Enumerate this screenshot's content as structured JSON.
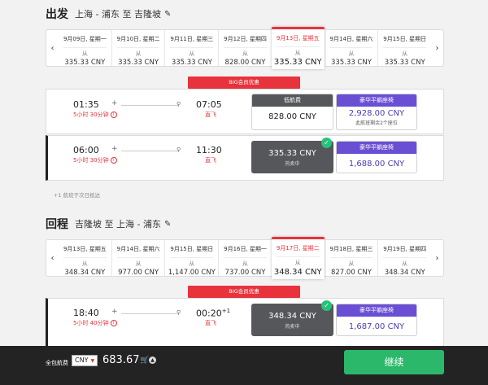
{
  "outbound": {
    "title": "出发",
    "route": "上海 - 浦东 至 吉隆坡",
    "dates": [
      {
        "date": "9月09日, 星期一",
        "from": "从",
        "price": "335.33 CNY"
      },
      {
        "date": "9月10日, 星期二",
        "from": "从",
        "price": "335.33 CNY"
      },
      {
        "date": "9月11日, 星期三",
        "from": "从",
        "price": "335.33 CNY"
      },
      {
        "date": "9月12日, 星期四",
        "from": "从",
        "price": "828.00 CNY"
      },
      {
        "date": "9月13日, 星期五",
        "from": "从",
        "price": "335.33 CNY"
      },
      {
        "date": "9月14日, 星期六",
        "from": "从",
        "price": "335.33 CNY"
      },
      {
        "date": "9月15日, 星期日",
        "from": "从",
        "price": "335.33 CNY"
      }
    ],
    "big_tag": "BIG会员优惠",
    "flights": [
      {
        "dep": "01:35",
        "arr": "07:05",
        "duration": "5小时 30分钟",
        "type": "直飞",
        "eco_header": "低航费",
        "eco_price": "828.00 CNY",
        "lux_header": "豪华平躺座椅",
        "lux_price": "2,928.00 CNY",
        "lux_seats": "此航班剩余2个座位"
      },
      {
        "dep": "06:00",
        "arr": "11:30",
        "duration": "5小时 30分钟",
        "type": "直飞",
        "eco_price": "335.33 CNY",
        "eco_sub": "热卖中",
        "lux_header": "豪华平躺座椅",
        "lux_price": "1,688.00 CNY"
      }
    ],
    "note": "+1 航班于次日抵达"
  },
  "return": {
    "title": "回程",
    "route": "吉隆坡 至 上海 - 浦东",
    "dates": [
      {
        "date": "9月13日, 星期五",
        "from": "从",
        "price": "348.34 CNY"
      },
      {
        "date": "9月14日, 星期六",
        "from": "从",
        "price": "977.00 CNY"
      },
      {
        "date": "9月15日, 星期日",
        "from": "从",
        "price": "1,147.00 CNY"
      },
      {
        "date": "9月16日, 星期一",
        "from": "从",
        "price": "737.00 CNY"
      },
      {
        "date": "9月17日, 星期二",
        "from": "从",
        "price": "348.34 CNY"
      },
      {
        "date": "9月18日, 星期三",
        "from": "从",
        "price": "827.00 CNY"
      },
      {
        "date": "9月19日, 星期四",
        "from": "从",
        "price": "348.34 CNY"
      }
    ],
    "big_tag": "BIG会员优惠",
    "flight": {
      "dep": "18:40",
      "arr": "00:20",
      "arr_sup": "+1",
      "duration": "5小时 40分钟",
      "type": "直飞",
      "eco_price": "348.34 CNY",
      "eco_sub": "热卖中",
      "lux_header": "豪华平躺座椅",
      "lux_price": "1,687.00 CNY"
    }
  },
  "footer": {
    "label": "全包航费",
    "currency": "CNY",
    "total": "683.67",
    "continue": "继续"
  },
  "colors": {
    "accent_red": "#e8323c",
    "luxury_purple": "#6a4fd4",
    "continue_green": "#2cb86b",
    "selected_gray": "#55575b"
  }
}
